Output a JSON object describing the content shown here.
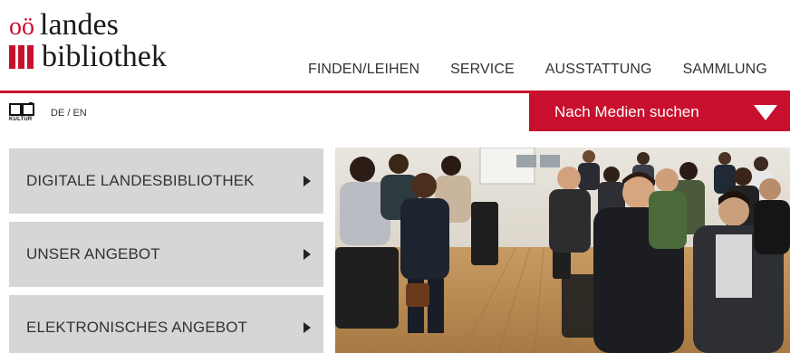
{
  "logo": {
    "line1_prefix": "oö",
    "line1": "landes",
    "line2": "bibliothek"
  },
  "nav": {
    "items": [
      "FINDEN/LEIHEN",
      "SERVICE",
      "AUSSTATTUNG",
      "SAMMLUNG"
    ]
  },
  "kultur": {
    "label": "KULTUR"
  },
  "language": {
    "label": "DE / EN"
  },
  "search": {
    "label": "Nach Medien suchen"
  },
  "menu": {
    "items": [
      {
        "label": "DIGITALE LANDESBIBLIOTHEK"
      },
      {
        "label": "UNSER ANGEBOT"
      },
      {
        "label": "ELEKTRONISCHES ANGEBOT"
      }
    ]
  },
  "colors": {
    "accent": "#c8102e",
    "tile": "#d6d6d6"
  },
  "icons": [
    "kultur-book-icon",
    "chevron-down-icon",
    "chevron-right-icon"
  ]
}
